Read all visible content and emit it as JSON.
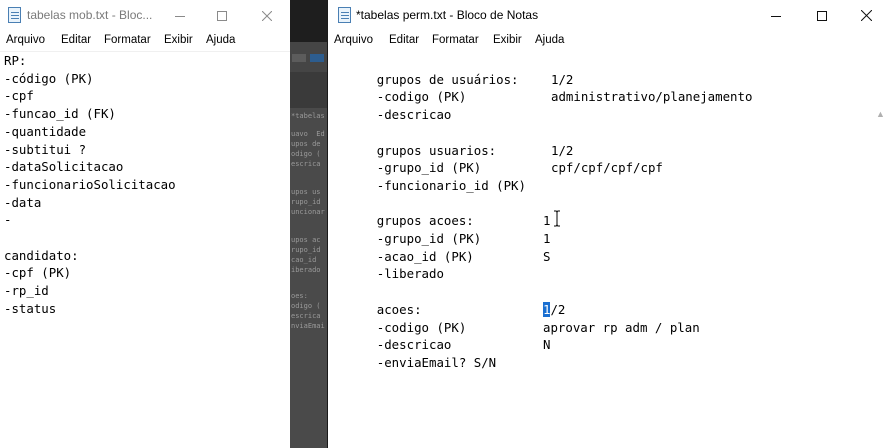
{
  "back_window": {
    "title": "tabelas mob.txt - Bloc...",
    "menu": [
      "Arquivo",
      "Editar",
      "Formatar",
      "Exibir",
      "Ajuda"
    ],
    "lines": [
      "RP:",
      "-código (PK)",
      "-cpf",
      "-funcao_id (FK)",
      "-quantidade",
      "-subtitui ?",
      "-dataSolicitacao",
      "-funcionarioSolicitacao",
      "-data",
      "-",
      "",
      "candidato:",
      "-cpf (PK)",
      "-rp_id",
      "-status"
    ]
  },
  "front_window": {
    "title": "*tabelas perm.txt - Bloco de Notas",
    "menu": [
      "Arquivo",
      "Editar",
      "Formatar",
      "Exibir",
      "Ajuda"
    ],
    "lines": [
      {
        "k": "grupos de usuários:",
        "v": ""
      },
      {
        "k": "-codigo (PK)",
        "v": "1/2"
      },
      {
        "k": "-descricao",
        "v": "administrativo/planejamento"
      },
      {
        "k": "",
        "v": ""
      },
      {
        "k": "grupos usuarios:",
        "v": ""
      },
      {
        "k": "-grupo_id (PK)",
        "v": "1/2"
      },
      {
        "k": "-funcionario_id (PK)",
        "v": "cpf/cpf/cpf/cpf"
      },
      {
        "k": "",
        "v": ""
      },
      {
        "k": "grupos acoes:",
        "v": ""
      },
      {
        "k": "-grupo_id (PK)",
        "v": "1"
      },
      {
        "k": "-acao_id (PK)",
        "v": "1"
      },
      {
        "k": "-liberado",
        "v": "S"
      },
      {
        "k": "",
        "v": ""
      },
      {
        "k": "acoes:",
        "v": ""
      },
      {
        "k": "-codigo (PK)",
        "v": "/2",
        "selected": "1"
      },
      {
        "k": "-descricao",
        "v": "aprovar rp adm / plan"
      },
      {
        "k": "-enviaEmail? S/N",
        "v": "N"
      }
    ]
  },
  "background_app": {
    "ghost_text": [
      "*tabelas p",
      "uavo  Ed",
      "upos de",
      "odigo (",
      "escrica",
      "",
      "upos us",
      "rupo_id",
      "uncionar",
      "",
      "upos ac",
      "rupo_id",
      "cao_id",
      "iberado",
      "",
      "oes:",
      "odigo (",
      "escrica",
      "nviaEmai"
    ]
  },
  "colors": {
    "selection": "#1a6fd1",
    "title_inactive": "#7a7a7a"
  }
}
